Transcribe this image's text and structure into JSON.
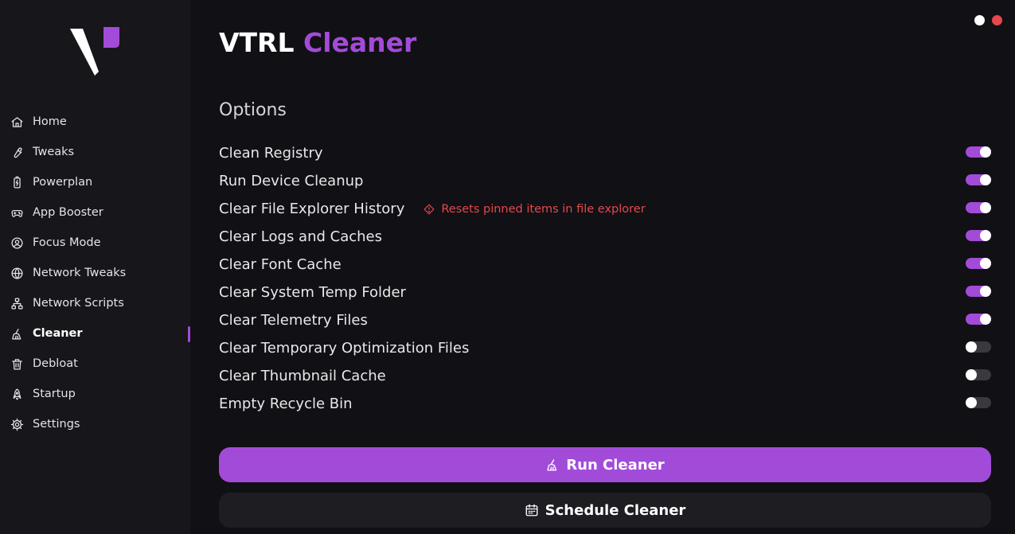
{
  "app": {
    "title_part1": "VTRL",
    "title_part2": "Cleaner",
    "accent_color": "#a34bd9"
  },
  "window_controls": [
    {
      "name": "minimize",
      "color": "#ffffff"
    },
    {
      "name": "close",
      "color": "#e5484d"
    }
  ],
  "sidebar": {
    "items": [
      {
        "label": "Home",
        "icon": "home-icon",
        "active": false
      },
      {
        "label": "Tweaks",
        "icon": "wrench-icon",
        "active": false
      },
      {
        "label": "Powerplan",
        "icon": "battery-icon",
        "active": false
      },
      {
        "label": "App Booster",
        "icon": "gamepad-icon",
        "active": false
      },
      {
        "label": "Focus Mode",
        "icon": "user-circle-icon",
        "active": false
      },
      {
        "label": "Network Tweaks",
        "icon": "globe-icon",
        "active": false
      },
      {
        "label": "Network Scripts",
        "icon": "network-icon",
        "active": false
      },
      {
        "label": "Cleaner",
        "icon": "broom-icon",
        "active": true
      },
      {
        "label": "Debloat",
        "icon": "trash-icon",
        "active": false
      },
      {
        "label": "Startup",
        "icon": "rocket-icon",
        "active": false
      },
      {
        "label": "Settings",
        "icon": "gear-icon",
        "active": false
      }
    ]
  },
  "options": {
    "heading": "Options",
    "items": [
      {
        "label": "Clean Registry",
        "enabled": true,
        "note": ""
      },
      {
        "label": "Run Device Cleanup",
        "enabled": true,
        "note": ""
      },
      {
        "label": "Clear File Explorer History",
        "enabled": true,
        "note": "Resets pinned items in file explorer"
      },
      {
        "label": "Clear Logs and Caches",
        "enabled": true,
        "note": ""
      },
      {
        "label": "Clear Font Cache",
        "enabled": true,
        "note": ""
      },
      {
        "label": "Clear System Temp Folder",
        "enabled": true,
        "note": ""
      },
      {
        "label": "Clear Telemetry Files",
        "enabled": true,
        "note": ""
      },
      {
        "label": "Clear Temporary Optimization Files",
        "enabled": false,
        "note": ""
      },
      {
        "label": "Clear Thumbnail Cache",
        "enabled": false,
        "note": ""
      },
      {
        "label": "Empty Recycle Bin",
        "enabled": false,
        "note": ""
      }
    ]
  },
  "actions": {
    "run_label": "Run Cleaner",
    "run_icon": "broom-icon",
    "schedule_label": "Schedule Cleaner",
    "schedule_icon": "calendar-icon"
  }
}
